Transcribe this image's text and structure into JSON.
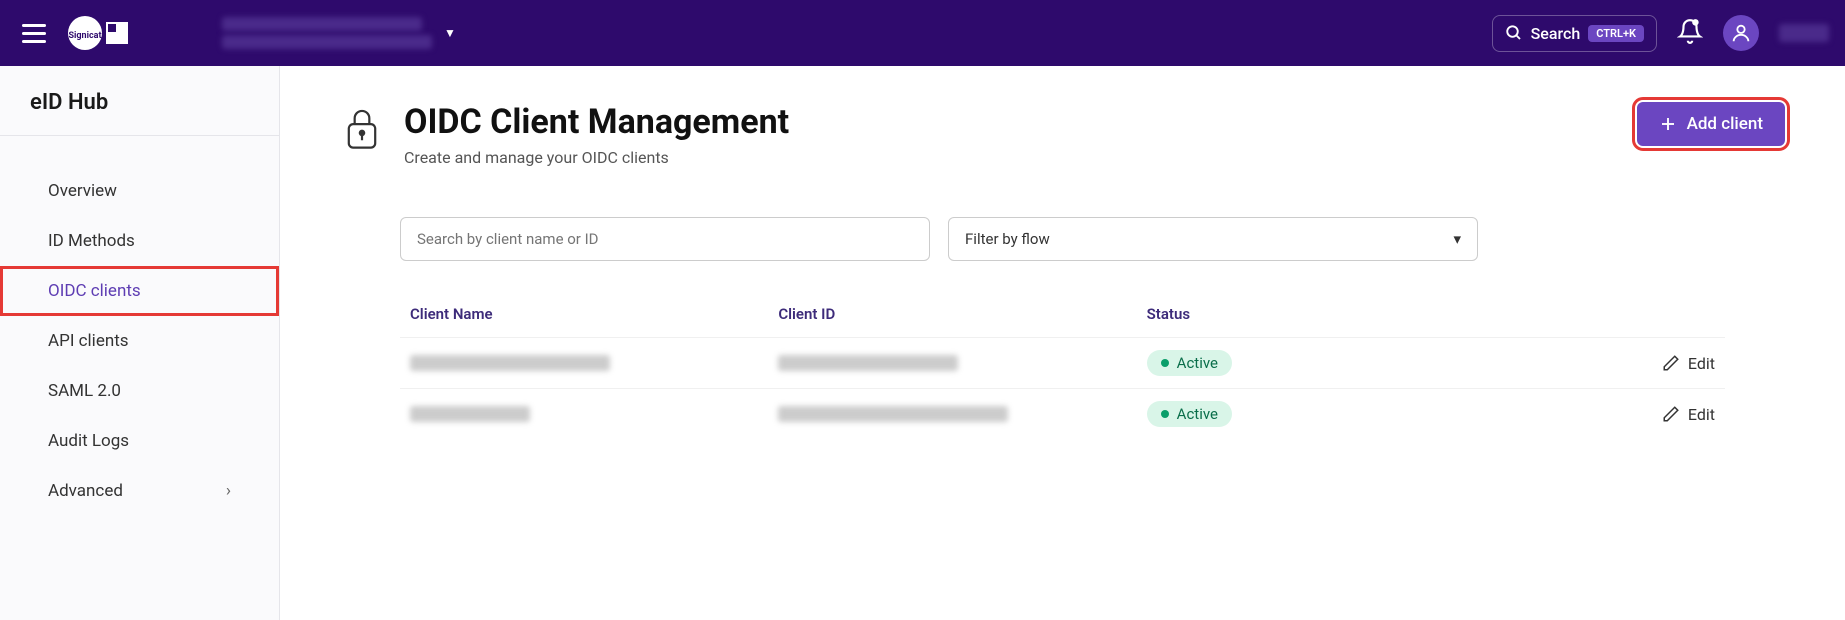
{
  "header": {
    "search_label": "Search",
    "search_shortcut": "CTRL+K"
  },
  "sidebar": {
    "title": "eID Hub",
    "items": [
      {
        "label": "Overview"
      },
      {
        "label": "ID Methods"
      },
      {
        "label": "OIDC clients"
      },
      {
        "label": "API clients"
      },
      {
        "label": "SAML 2.0"
      },
      {
        "label": "Audit Logs"
      },
      {
        "label": "Advanced"
      }
    ]
  },
  "page": {
    "title": "OIDC Client Management",
    "subtitle": "Create and manage your OIDC clients",
    "add_button": "Add client",
    "search_placeholder": "Search by client name or ID",
    "filter_label": "Filter by flow"
  },
  "table": {
    "columns": {
      "name": "Client Name",
      "id": "Client ID",
      "status": "Status",
      "edit": "Edit"
    },
    "rows": [
      {
        "status": "Active"
      },
      {
        "status": "Active"
      }
    ]
  }
}
